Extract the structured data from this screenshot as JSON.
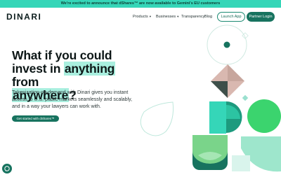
{
  "banner": {
    "text": "We're excited to announce that dShares™ are now available to Gemini's EU customers"
  },
  "nav": {
    "logo": "DINARI",
    "products": "Products",
    "businesses": "Businesses",
    "transparency": "Transparency",
    "blog": "Blog",
    "launch_app": "Launch App",
    "partner_login": "Partner Login"
  },
  "hero": {
    "line1": "What if you could",
    "line2_pre": "invest in ",
    "line2_hl": "anything",
    "line2_post": " from",
    "line3_hl": "anywhere",
    "line3_post": "?",
    "subtext": "Tokenization-on-demand with Dinari gives you instant access to U.S. public markets seamlessly and scalably, and in a way your lawyers can work with.",
    "cta": "Get started with dShares™"
  },
  "colors": {
    "banner": "#35d6b8",
    "brand_dark": "#17735f",
    "highlight": "#a9efdf",
    "accent_green": "#3bd46e"
  }
}
